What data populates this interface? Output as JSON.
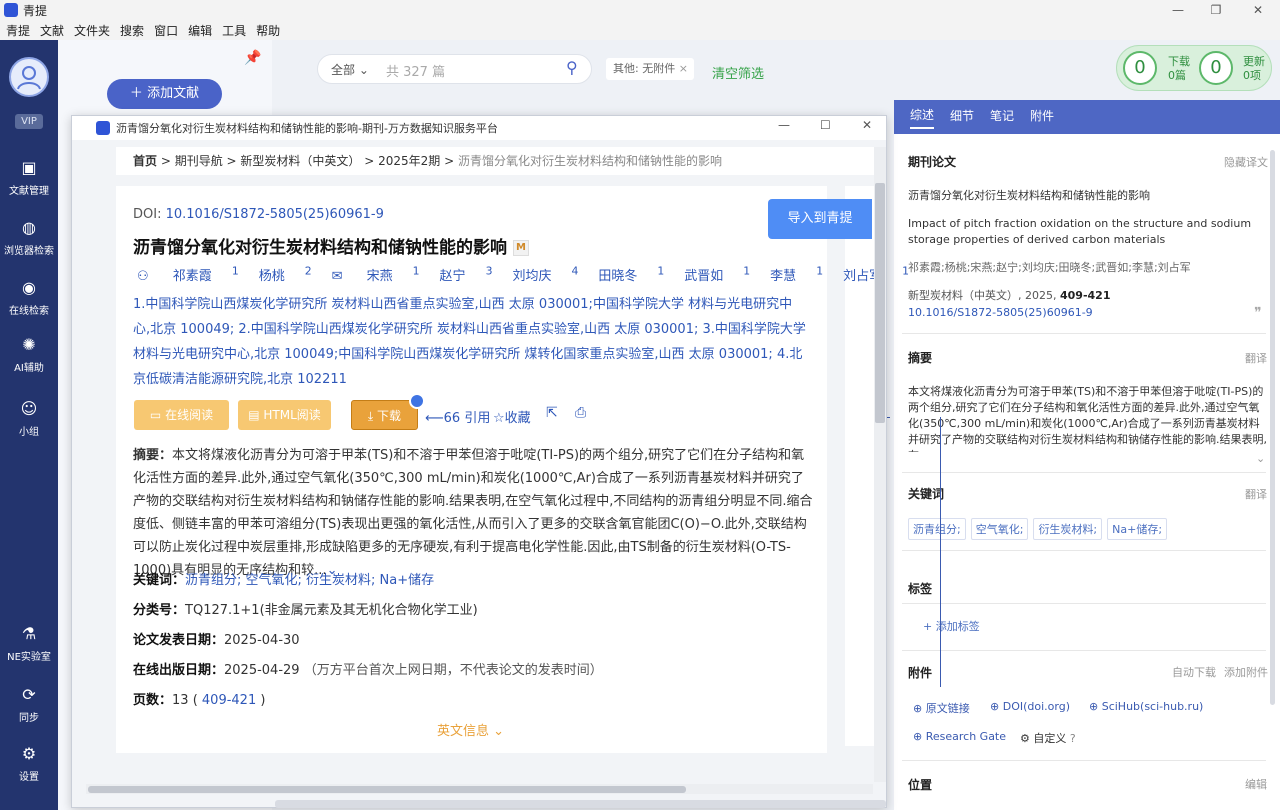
{
  "app": {
    "title": "青提",
    "menu": [
      "青提",
      "文献",
      "文件夹",
      "搜索",
      "窗口",
      "编辑",
      "工具",
      "帮助"
    ]
  },
  "sidebar": {
    "vip": "VIP",
    "items": [
      {
        "label": "文献管理",
        "icon": "box-icon"
      },
      {
        "label": "浏览器检索",
        "icon": "globe-icon"
      },
      {
        "label": "在线检索",
        "icon": "eye-icon"
      },
      {
        "label": "AI辅助",
        "icon": "bulb-icon"
      },
      {
        "label": "小组",
        "icon": "group-icon"
      },
      {
        "label": "NE实验室",
        "icon": "flask-icon"
      },
      {
        "label": "同步",
        "icon": "sync-icon"
      },
      {
        "label": "设置",
        "icon": "gear-icon"
      }
    ]
  },
  "library": {
    "add_label": "添加文献"
  },
  "toolbar": {
    "scope": "全部",
    "search_placeholder": "共 327 篇",
    "filter_chip": "其他: 无附件",
    "clear_filter": "清空筛选",
    "download": {
      "count": "0",
      "label": "下载",
      "sub": "0篇"
    },
    "update": {
      "count": "0",
      "label": "更新",
      "sub": "0项"
    }
  },
  "dialog": {
    "title": "沥青馏分氧化对衍生炭材料结构和储钠性能的影响-期刊-万方数据知识服务平台",
    "breadcrumb": [
      "首页",
      "期刊导航",
      "新型炭材料（中英文）",
      "2025年2期",
      "沥青馏分氧化对衍生炭材料结构和储钠性能的影响"
    ],
    "doi_label": "DOI:",
    "doi": "10.1016/S1872-5805(25)60961-9",
    "paper_title": "沥青馏分氧化对衍生炭材料结构和储钠性能的影响",
    "import_label": "导入到青提",
    "authors": [
      {
        "name": "祁素霞",
        "sup": "1"
      },
      {
        "name": "杨桃",
        "sup": "2"
      },
      {
        "name": "宋燕",
        "sup": "1"
      },
      {
        "name": "赵宁",
        "sup": "3"
      },
      {
        "name": "刘均庆",
        "sup": "4"
      },
      {
        "name": "田晓冬",
        "sup": "1"
      },
      {
        "name": "武晋如",
        "sup": "1"
      },
      {
        "name": "李慧",
        "sup": "1"
      },
      {
        "name": "刘占军",
        "sup": "1"
      }
    ],
    "affiliations": "1.中国科学院山西煤炭化学研究所 炭材料山西省重点实验室,山西 太原 030001;中国科学院大学 材料与光电研究中心,北京 100049; 2.中国科学院山西煤炭化学研究所 炭材料山西省重点实验室,山西 太原 030001; 3.中国科学院大学 材料与光电研究中心,北京 100049;中国科学院山西煤炭化学研究所 煤转化国家重点实验室,山西 太原 030001; 4.北京低碳清洁能源研究院,北京 102211",
    "buttons": {
      "online_read": "在线阅读",
      "html_read": "HTML阅读",
      "download": "下载",
      "cite": "引用",
      "collect": "收藏"
    },
    "abstract_label": "摘要：",
    "abstract": "本文将煤液化沥青分为可溶于甲苯(TS)和不溶于甲苯但溶于吡啶(TI-PS)的两个组分,研究了它们在分子结构和氧化活性方面的差异.此外,通过空气氧化(350℃,300 mL/min)和炭化(1000℃,Ar)合成了一系列沥青基炭材料并研究了产物的交联结构对衍生炭材料结构和钠储存性能的影响.结果表明,在空气氧化过程中,不同结构的沥青组分明显不同.缩合度低、侧链丰富的甲苯可溶组分(TS)表现出更强的氧化活性,从而引入了更多的交联含氧官能团C(O)−O.此外,交联结构可以防止炭化过程中炭层重排,形成缺陷更多的无序硬炭,有利于提高电化学性能.因此,由TS制备的衍生炭材料(O-TS-1000)具有明显的无序结构和较...",
    "keywords_label": "关键词：",
    "keywords": "沥青组分; 空气氧化; 衍生炭材料; Na+储存",
    "class_label": "分类号：",
    "class_value": "TQ127.1+1(非金属元素及其无机化合物化学工业)",
    "pubdate_label": "论文发表日期：",
    "pubdate": "2025-04-30",
    "onlinedate_label": "在线出版日期：",
    "onlinedate": "2025-04-29",
    "onlinedate_note": "（万方平台首次上网日期，不代表论文的发表时间）",
    "pages_label": "页数：",
    "pages_count": "13",
    "pages_range": "409-421",
    "english_info": "英文信息"
  },
  "right_panel": {
    "tabs": [
      "综述",
      "细节",
      "笔记",
      "附件"
    ],
    "section_journal": "期刊论文",
    "hide_translation": "隐藏译文",
    "title_cn": "沥青馏分氧化对衍生炭材料结构和储钠性能的影响",
    "title_en": "Impact of pitch fraction oxidation on the structure and sodium storage properties of derived carbon materials",
    "authors": "祁素霞;杨桃;宋燕;赵宁;刘均庆;田晓冬;武晋如;李慧;刘占军",
    "journal": "新型炭材料（中英文）, 2025,",
    "journal_pages": "409-421",
    "doi": "10.1016/S1872-5805(25)60961-9",
    "abstract_head": "摘要",
    "translate": "翻译",
    "abstract": "本文将煤液化沥青分为可溶于甲苯(TS)和不溶于甲苯但溶于吡啶(TI-PS)的两个组分,研究了它们在分子结构和氧化活性方面的差异.此外,通过空气氧化(350℃,300 mL/min)和炭化(1000℃,Ar)合成了一系列沥青基炭材料并研究了产物的交联结构对衍生炭材料结构和钠储存性能的影响.结果表明,在...",
    "keywords_head": "关键词",
    "keywords": [
      "沥青组分;",
      "空气氧化;",
      "衍生炭材料;",
      "Na+储存;"
    ],
    "tags_head": "标签",
    "add_tag": "+ 添加标签",
    "attach_head": "附件",
    "auto_download": "自动下载",
    "add_attach": "添加附件",
    "links": [
      "原文链接",
      "DOI(doi.org)",
      "SciHub(sci-hub.ru)",
      "Research Gate",
      "自定义"
    ],
    "location_head": "位置",
    "edit": "编辑"
  },
  "colors": {
    "sidebar": "#23346e",
    "accent": "#4e67c4",
    "download_btn": "#e9a23b",
    "link": "#2e57b8"
  }
}
